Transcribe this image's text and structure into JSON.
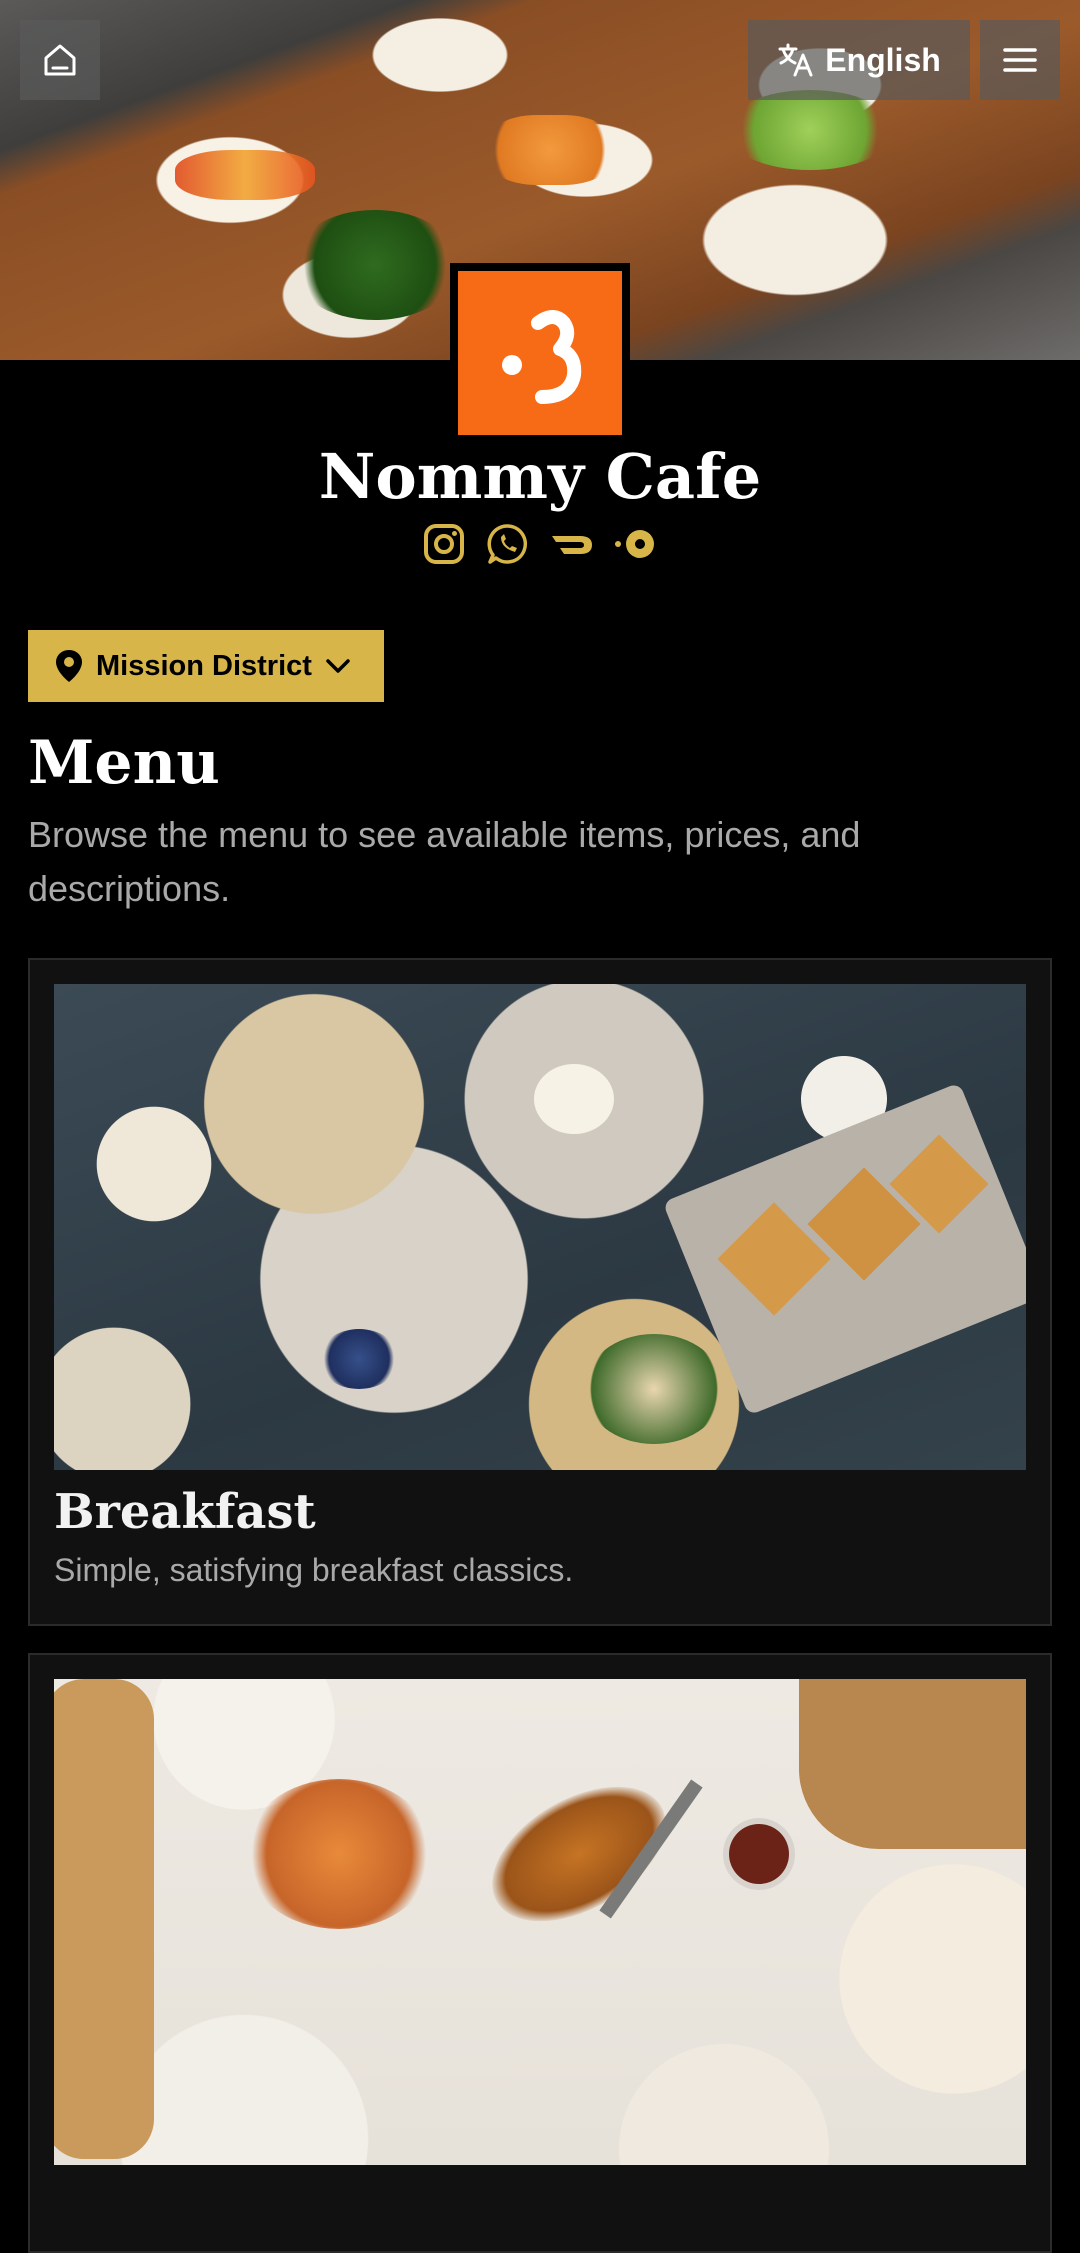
{
  "header": {
    "language_label": "English",
    "icons": {
      "home": "home-icon",
      "language": "translate-icon",
      "menu": "hamburger-menu-icon"
    }
  },
  "cafe": {
    "name": "Nommy Cafe",
    "logo_color": "#f76b16",
    "socials": [
      "instagram-icon",
      "whatsapp-icon",
      "doordash-icon",
      "grubhub-icon"
    ]
  },
  "location": {
    "label": "Mission District",
    "icon": "location-pin-icon"
  },
  "menu": {
    "title": "Menu",
    "description": "Browse the menu to see available items, prices, and descriptions."
  },
  "categories": [
    {
      "title": "Breakfast",
      "description": "Simple, satisfying breakfast classics."
    },
    {
      "title": "",
      "description": ""
    }
  ],
  "colors": {
    "accent": "#d8b548",
    "background": "#000000",
    "card": "#111111",
    "muted_text": "#a9a9a9"
  }
}
